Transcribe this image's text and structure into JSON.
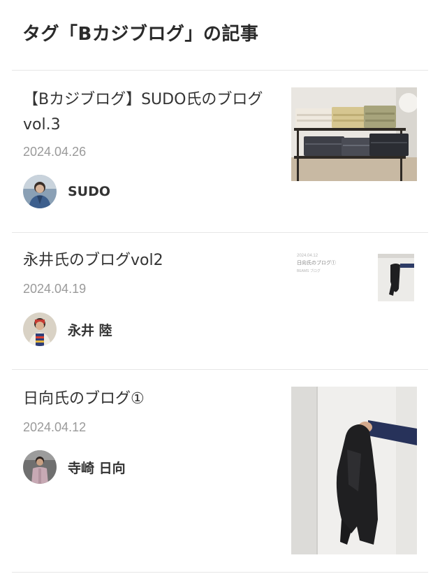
{
  "page": {
    "title": "タグ「Bカジブログ」の記事"
  },
  "articles": [
    {
      "title": "【Bカジブログ】SUDO氏のブログvol.3",
      "date": "2024.04.26",
      "author": "SUDO",
      "thumbnail": "shelf-of-folded-pants-photo"
    },
    {
      "title": "永井氏のブログvol2",
      "date": "2024.04.19",
      "author": "永井 陸",
      "thumbnail": "blog-preview-card",
      "thumb_text": {
        "date": "2024.04.12",
        "title": "日向氏のブログ①",
        "sub": "BEAMS ブログ"
      }
    },
    {
      "title": "日向氏のブログ①",
      "date": "2024.04.12",
      "author": "寺崎 日向",
      "thumbnail": "hand-holding-black-jacket-photo"
    }
  ],
  "colors": {
    "text": "#333333",
    "date": "#9a9a9a",
    "divider": "#e6e6e6"
  }
}
